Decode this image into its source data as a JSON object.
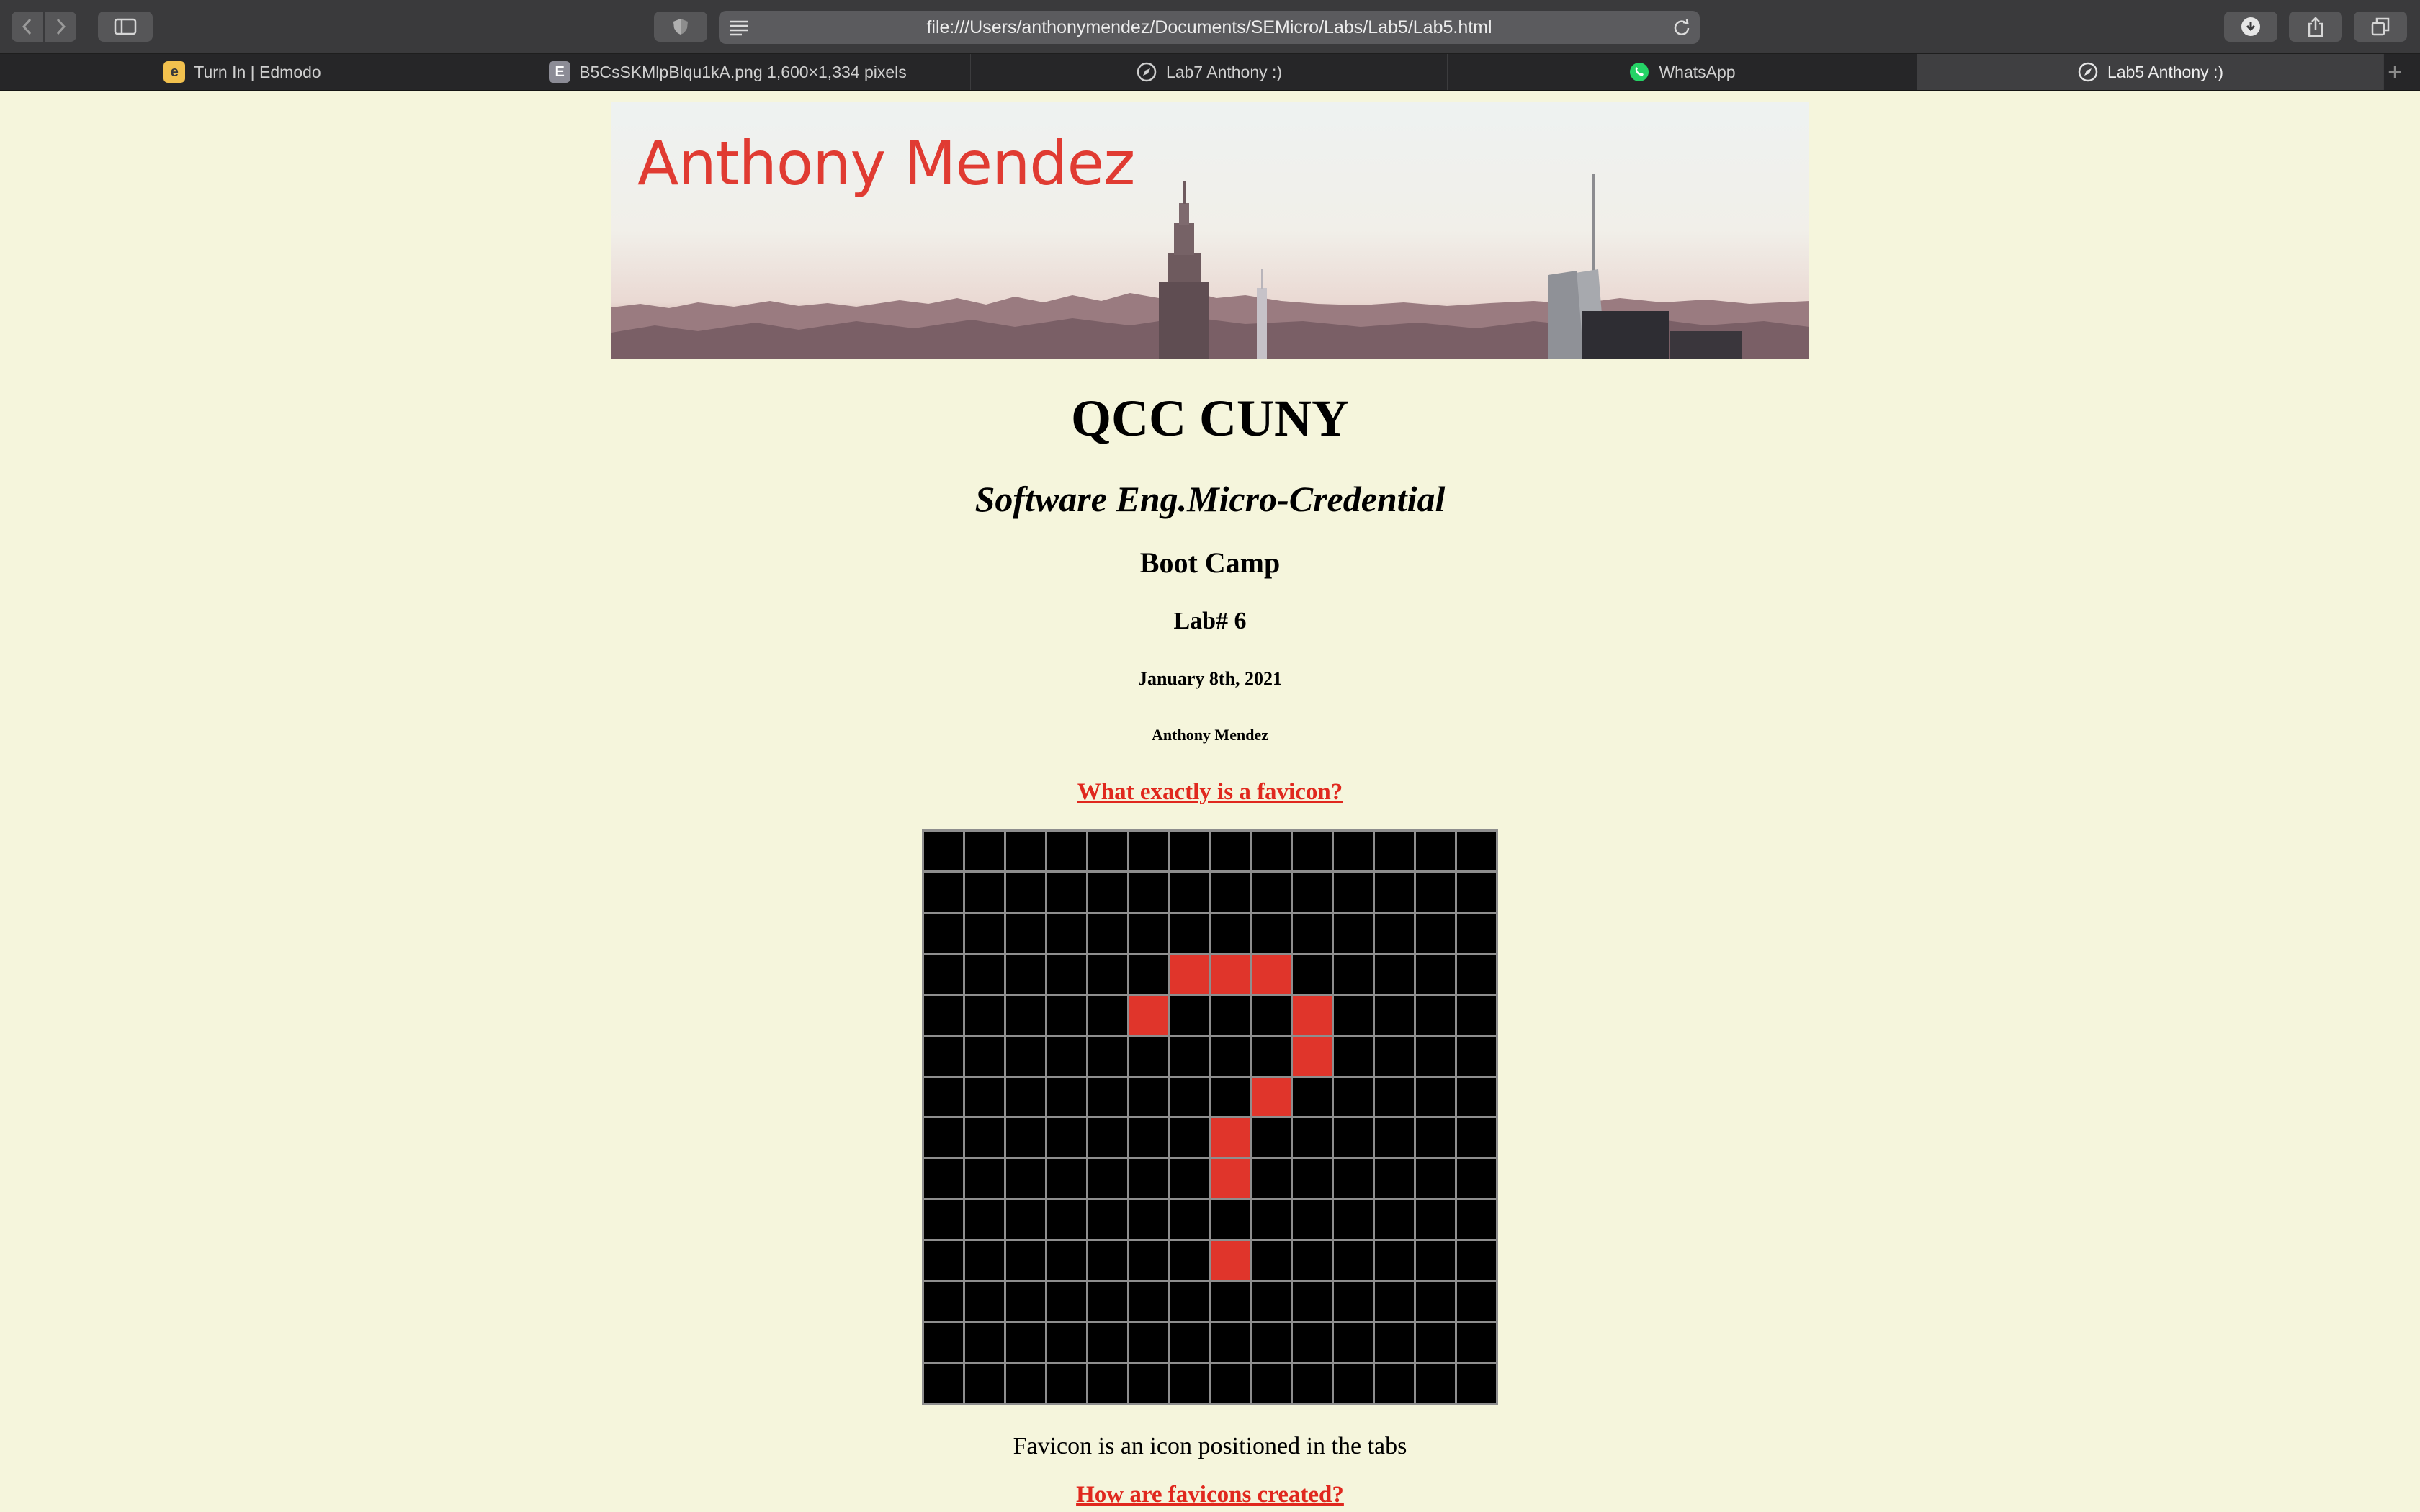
{
  "browser": {
    "address": "file:///Users/anthonymendez/Documents/SEMicro/Labs/Lab5/Lab5.html",
    "tabs": [
      {
        "label": "Turn In | Edmodo",
        "icon": "edmodo-icon",
        "icon_char": "e",
        "icon_bg": "#f2c14e",
        "icon_fg": "#3a3a3a"
      },
      {
        "label": "B5CsSKMlpBlqu1kA.png 1,600×1,334 pixels",
        "icon": "image-file-icon",
        "icon_char": "E",
        "icon_bg": "#8c8c96",
        "icon_fg": "#ffffff"
      },
      {
        "label": "Lab7 Anthony :)",
        "icon": "compass-icon",
        "icon_char": "",
        "icon_bg": "transparent",
        "icon_fg": "#cfcfcf"
      },
      {
        "label": "WhatsApp",
        "icon": "whatsapp-icon",
        "icon_char": "",
        "icon_bg": "#25d366",
        "icon_fg": "#ffffff"
      },
      {
        "label": "Lab5 Anthony :)",
        "icon": "compass-icon",
        "icon_char": "",
        "icon_bg": "transparent",
        "icon_fg": "#cfcfcf",
        "active": true
      }
    ],
    "new_tab": "+"
  },
  "page": {
    "banner_name": "Anthony Mendez",
    "title": "QCC CUNY",
    "subtitle": "Software Eng.Micro-Credential",
    "boot_camp": "Boot Camp",
    "lab": "Lab# 6",
    "date": "January 8th, 2021",
    "author": "Anthony Mendez",
    "link1": "What exactly is a favicon?",
    "favicon_text": "Favicon is an icon positioned in the tabs",
    "link2": "How are favicons created?"
  },
  "pixel_grid": {
    "size": 14,
    "on_color": "#e0352b",
    "off_color": "#000000",
    "on_cells": [
      [
        3,
        6
      ],
      [
        3,
        7
      ],
      [
        3,
        8
      ],
      [
        4,
        5
      ],
      [
        4,
        9
      ],
      [
        5,
        9
      ],
      [
        6,
        8
      ],
      [
        7,
        7
      ],
      [
        8,
        7
      ],
      [
        10,
        7
      ]
    ]
  },
  "colors": {
    "page_bg": "#f5f5dc",
    "link": "#e0281e",
    "banner_name": "#e03b32"
  }
}
